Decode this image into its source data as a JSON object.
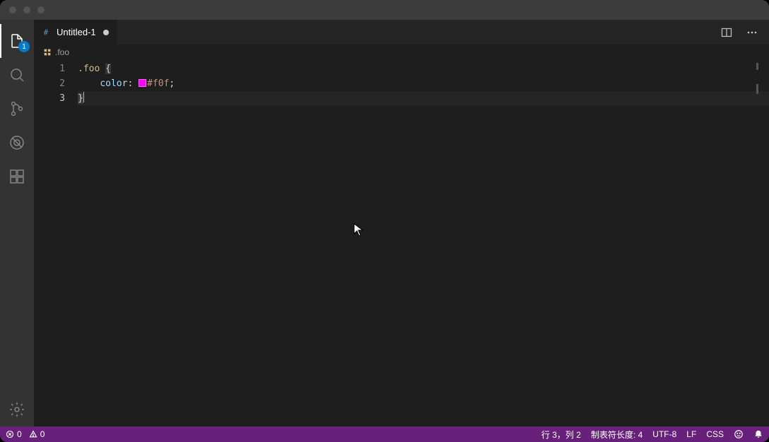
{
  "activitybar": {
    "explorer_badge": "1"
  },
  "tab": {
    "title": "Untitled-1"
  },
  "breadcrumb": {
    "label": ".foo"
  },
  "gutter": {
    "l1": "1",
    "l2": "2",
    "l3": "3"
  },
  "code": {
    "line1_sel": ".foo",
    "line1_brace": "{",
    "line2_prop": "color",
    "line2_colon": ":",
    "line2_val": "#f0f",
    "line2_semi": ";",
    "line3_brace": "}",
    "swatch_color": "#f0f"
  },
  "status": {
    "errors": "0",
    "warnings": "0",
    "lncol": "行 3，列 2",
    "tabsize": "制表符长度: 4",
    "encoding": "UTF-8",
    "eol": "LF",
    "language": "CSS"
  }
}
